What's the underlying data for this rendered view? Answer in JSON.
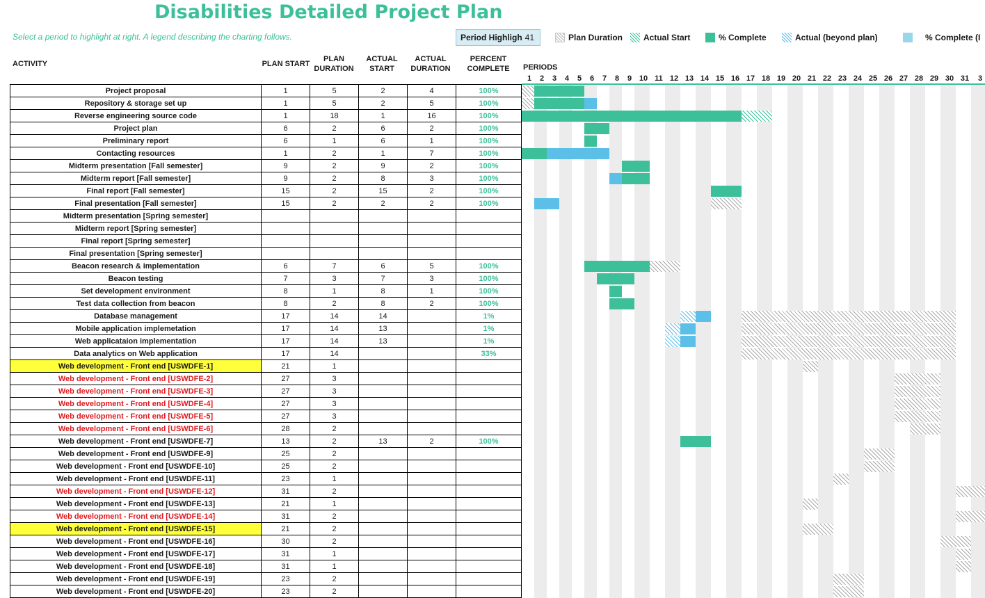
{
  "title": "Disabilities Detailed Project Plan",
  "subtitle": "Select a period to highlight at right.  A legend describing the charting follows.",
  "period_highlight": {
    "label": "Period Highligh",
    "value": "41"
  },
  "legend": [
    "Plan Duration",
    "Actual Start",
    "% Complete",
    "Actual (beyond plan)",
    "% Complete (I"
  ],
  "colors": {
    "accent": "#3dbf9a",
    "blue": "#5bbfe8",
    "highlight": "#ffff3a",
    "red_text": "#e0191e"
  },
  "headers": {
    "activity": "ACTIVITY",
    "plan_start": "PLAN START",
    "plan_duration": "PLAN DURATION",
    "actual_start": "ACTUAL START",
    "actual_duration": "ACTUAL DURATION",
    "percent_complete": "PERCENT COMPLETE",
    "periods": "PERIODS"
  },
  "period_numbers": [
    "1",
    "2",
    "3",
    "4",
    "5",
    "6",
    "7",
    "8",
    "9",
    "10",
    "11",
    "12",
    "13",
    "14",
    "15",
    "16",
    "17",
    "18",
    "19",
    "20",
    "21",
    "22",
    "23",
    "24",
    "25",
    "26",
    "27",
    "28",
    "29",
    "30",
    "31",
    "3"
  ],
  "rows": [
    {
      "activity": "Project proposal",
      "plan_start": "1",
      "plan_duration": "5",
      "actual_start": "2",
      "actual_duration": "4",
      "percent": "100%",
      "style": ""
    },
    {
      "activity": "Repository & storage set up",
      "plan_start": "1",
      "plan_duration": "5",
      "actual_start": "2",
      "actual_duration": "5",
      "percent": "100%",
      "style": ""
    },
    {
      "activity": "Reverse engineering source code",
      "plan_start": "1",
      "plan_duration": "18",
      "actual_start": "1",
      "actual_duration": "16",
      "percent": "100%",
      "style": ""
    },
    {
      "activity": "Project plan",
      "plan_start": "6",
      "plan_duration": "2",
      "actual_start": "6",
      "actual_duration": "2",
      "percent": "100%",
      "style": ""
    },
    {
      "activity": "Preliminary report",
      "plan_start": "6",
      "plan_duration": "1",
      "actual_start": "6",
      "actual_duration": "1",
      "percent": "100%",
      "style": ""
    },
    {
      "activity": "Contacting resources",
      "plan_start": "1",
      "plan_duration": "2",
      "actual_start": "1",
      "actual_duration": "7",
      "percent": "100%",
      "style": ""
    },
    {
      "activity": "Midterm presentation [Fall semester]",
      "plan_start": "9",
      "plan_duration": "2",
      "actual_start": "9",
      "actual_duration": "2",
      "percent": "100%",
      "style": ""
    },
    {
      "activity": "Midterm report [Fall semester]",
      "plan_start": "9",
      "plan_duration": "2",
      "actual_start": "8",
      "actual_duration": "3",
      "percent": "100%",
      "style": ""
    },
    {
      "activity": "Final report [Fall semester]",
      "plan_start": "15",
      "plan_duration": "2",
      "actual_start": "15",
      "actual_duration": "2",
      "percent": "100%",
      "style": ""
    },
    {
      "activity": "Final presentation [Fall semester]",
      "plan_start": "15",
      "plan_duration": "2",
      "actual_start": "2",
      "actual_duration": "2",
      "percent": "100%",
      "style": ""
    },
    {
      "activity": "Midterm presentation [Spring semester]",
      "plan_start": "",
      "plan_duration": "",
      "actual_start": "",
      "actual_duration": "",
      "percent": "",
      "style": ""
    },
    {
      "activity": "Midterm report [Spring semester]",
      "plan_start": "",
      "plan_duration": "",
      "actual_start": "",
      "actual_duration": "",
      "percent": "",
      "style": ""
    },
    {
      "activity": "Final report [Spring semester]",
      "plan_start": "",
      "plan_duration": "",
      "actual_start": "",
      "actual_duration": "",
      "percent": "",
      "style": ""
    },
    {
      "activity": "Final presentation [Spring semester]",
      "plan_start": "",
      "plan_duration": "",
      "actual_start": "",
      "actual_duration": "",
      "percent": "",
      "style": ""
    },
    {
      "activity": "Beacon research & implementation",
      "plan_start": "6",
      "plan_duration": "7",
      "actual_start": "6",
      "actual_duration": "5",
      "percent": "100%",
      "style": ""
    },
    {
      "activity": "Beacon testing",
      "plan_start": "7",
      "plan_duration": "3",
      "actual_start": "7",
      "actual_duration": "3",
      "percent": "100%",
      "style": ""
    },
    {
      "activity": "Set development environment",
      "plan_start": "8",
      "plan_duration": "1",
      "actual_start": "8",
      "actual_duration": "1",
      "percent": "100%",
      "style": ""
    },
    {
      "activity": "Test data collection from beacon",
      "plan_start": "8",
      "plan_duration": "2",
      "actual_start": "8",
      "actual_duration": "2",
      "percent": "100%",
      "style": ""
    },
    {
      "activity": "Database management",
      "plan_start": "17",
      "plan_duration": "14",
      "actual_start": "14",
      "actual_duration": "",
      "percent": "1%",
      "style": ""
    },
    {
      "activity": "Mobile application implemetation",
      "plan_start": "17",
      "plan_duration": "14",
      "actual_start": "13",
      "actual_duration": "",
      "percent": "1%",
      "style": ""
    },
    {
      "activity": "Web applicataion implementation",
      "plan_start": "17",
      "plan_duration": "14",
      "actual_start": "13",
      "actual_duration": "",
      "percent": "1%",
      "style": ""
    },
    {
      "activity": "Data analytics on Web application",
      "plan_start": "17",
      "plan_duration": "14",
      "actual_start": "",
      "actual_duration": "",
      "percent": "33%",
      "style": ""
    },
    {
      "activity": "Web development - Front end [USWDFE-1]",
      "plan_start": "21",
      "plan_duration": "1",
      "actual_start": "",
      "actual_duration": "",
      "percent": "",
      "style": "hl"
    },
    {
      "activity": "Web development - Front end [USWDFE-2]",
      "plan_start": "27",
      "plan_duration": "3",
      "actual_start": "",
      "actual_duration": "",
      "percent": "",
      "style": "red"
    },
    {
      "activity": "Web development - Front end [USWDFE-3]",
      "plan_start": "27",
      "plan_duration": "3",
      "actual_start": "",
      "actual_duration": "",
      "percent": "",
      "style": "red"
    },
    {
      "activity": "Web development - Front end [USWDFE-4]",
      "plan_start": "27",
      "plan_duration": "3",
      "actual_start": "",
      "actual_duration": "",
      "percent": "",
      "style": "red"
    },
    {
      "activity": "Web development - Front end [USWDFE-5]",
      "plan_start": "27",
      "plan_duration": "3",
      "actual_start": "",
      "actual_duration": "",
      "percent": "",
      "style": "red"
    },
    {
      "activity": "Web development - Front end [USWDFE-6]",
      "plan_start": "28",
      "plan_duration": "2",
      "actual_start": "",
      "actual_duration": "",
      "percent": "",
      "style": "red"
    },
    {
      "activity": "Web development - Front end [USWDFE-7]",
      "plan_start": "13",
      "plan_duration": "2",
      "actual_start": "13",
      "actual_duration": "2",
      "percent": "100%",
      "style": ""
    },
    {
      "activity": "Web development - Front end [USWDFE-9]",
      "plan_start": "25",
      "plan_duration": "2",
      "actual_start": "",
      "actual_duration": "",
      "percent": "",
      "style": ""
    },
    {
      "activity": "Web development - Front end [USWDFE-10]",
      "plan_start": "25",
      "plan_duration": "2",
      "actual_start": "",
      "actual_duration": "",
      "percent": "",
      "style": ""
    },
    {
      "activity": "Web development - Front end [USWDFE-11]",
      "plan_start": "23",
      "plan_duration": "1",
      "actual_start": "",
      "actual_duration": "",
      "percent": "",
      "style": ""
    },
    {
      "activity": "Web development - Front end [USWDFE-12]",
      "plan_start": "31",
      "plan_duration": "2",
      "actual_start": "",
      "actual_duration": "",
      "percent": "",
      "style": "red"
    },
    {
      "activity": "Web development - Front end [USWDFE-13]",
      "plan_start": "21",
      "plan_duration": "1",
      "actual_start": "",
      "actual_duration": "",
      "percent": "",
      "style": ""
    },
    {
      "activity": "Web development - Front end [USWDFE-14]",
      "plan_start": "31",
      "plan_duration": "2",
      "actual_start": "",
      "actual_duration": "",
      "percent": "",
      "style": "red"
    },
    {
      "activity": "Web development - Front end [USWDFE-15]",
      "plan_start": "21",
      "plan_duration": "2",
      "actual_start": "",
      "actual_duration": "",
      "percent": "",
      "style": "hl"
    },
    {
      "activity": "Web development - Front end [USWDFE-16]",
      "plan_start": "30",
      "plan_duration": "2",
      "actual_start": "",
      "actual_duration": "",
      "percent": "",
      "style": ""
    },
    {
      "activity": "Web development - Front end [USWDFE-17]",
      "plan_start": "31",
      "plan_duration": "1",
      "actual_start": "",
      "actual_duration": "",
      "percent": "",
      "style": ""
    },
    {
      "activity": "Web development - Front end [USWDFE-18]",
      "plan_start": "31",
      "plan_duration": "1",
      "actual_start": "",
      "actual_duration": "",
      "percent": "",
      "style": ""
    },
    {
      "activity": "Web development - Front end [USWDFE-19]",
      "plan_start": "23",
      "plan_duration": "2",
      "actual_start": "",
      "actual_duration": "",
      "percent": "",
      "style": ""
    },
    {
      "activity": "Web development - Front end [USWDFE-20]",
      "plan_start": "23",
      "plan_duration": "2",
      "actual_start": "",
      "actual_duration": "",
      "percent": "",
      "style": ""
    }
  ],
  "gantt_bars": [
    {
      "row": 0,
      "start": 1,
      "len": 1,
      "kind": "plan"
    },
    {
      "row": 0,
      "start": 2,
      "len": 4,
      "kind": "comp"
    },
    {
      "row": 1,
      "start": 1,
      "len": 1,
      "kind": "plan"
    },
    {
      "row": 1,
      "start": 2,
      "len": 4,
      "kind": "comp"
    },
    {
      "row": 1,
      "start": 6,
      "len": 1,
      "kind": "blue"
    },
    {
      "row": 2,
      "start": 1,
      "len": 16,
      "kind": "comp"
    },
    {
      "row": 2,
      "start": 17,
      "len": 2,
      "kind": "hatchg"
    },
    {
      "row": 3,
      "start": 6,
      "len": 2,
      "kind": "comp"
    },
    {
      "row": 4,
      "start": 6,
      "len": 1,
      "kind": "comp"
    },
    {
      "row": 5,
      "start": 1,
      "len": 2,
      "kind": "comp"
    },
    {
      "row": 5,
      "start": 3,
      "len": 5,
      "kind": "blue"
    },
    {
      "row": 6,
      "start": 9,
      "len": 2,
      "kind": "comp"
    },
    {
      "row": 7,
      "start": 8,
      "len": 1,
      "kind": "blue"
    },
    {
      "row": 7,
      "start": 9,
      "len": 2,
      "kind": "comp"
    },
    {
      "row": 8,
      "start": 15,
      "len": 2,
      "kind": "comp"
    },
    {
      "row": 9,
      "start": 2,
      "len": 2,
      "kind": "blue"
    },
    {
      "row": 9,
      "start": 15,
      "len": 2,
      "kind": "plan"
    },
    {
      "row": 14,
      "start": 6,
      "len": 5,
      "kind": "comp"
    },
    {
      "row": 14,
      "start": 11,
      "len": 2,
      "kind": "plan"
    },
    {
      "row": 15,
      "start": 7,
      "len": 3,
      "kind": "comp"
    },
    {
      "row": 16,
      "start": 8,
      "len": 1,
      "kind": "comp"
    },
    {
      "row": 17,
      "start": 8,
      "len": 2,
      "kind": "comp"
    },
    {
      "row": 18,
      "start": 13,
      "len": 1,
      "kind": "hatchb"
    },
    {
      "row": 18,
      "start": 14,
      "len": 1,
      "kind": "blue"
    },
    {
      "row": 18,
      "start": 17,
      "len": 14,
      "kind": "plan"
    },
    {
      "row": 19,
      "start": 12,
      "len": 1,
      "kind": "hatchb"
    },
    {
      "row": 19,
      "start": 13,
      "len": 1,
      "kind": "blue"
    },
    {
      "row": 19,
      "start": 17,
      "len": 14,
      "kind": "plan"
    },
    {
      "row": 20,
      "start": 12,
      "len": 1,
      "kind": "hatchb"
    },
    {
      "row": 20,
      "start": 13,
      "len": 1,
      "kind": "blue"
    },
    {
      "row": 20,
      "start": 17,
      "len": 14,
      "kind": "plan"
    },
    {
      "row": 21,
      "start": 17,
      "len": 14,
      "kind": "plan"
    },
    {
      "row": 22,
      "start": 21,
      "len": 1,
      "kind": "plan"
    },
    {
      "row": 23,
      "start": 27,
      "len": 3,
      "kind": "plan"
    },
    {
      "row": 24,
      "start": 27,
      "len": 3,
      "kind": "plan"
    },
    {
      "row": 25,
      "start": 27,
      "len": 3,
      "kind": "plan"
    },
    {
      "row": 26,
      "start": 27,
      "len": 3,
      "kind": "plan"
    },
    {
      "row": 27,
      "start": 28,
      "len": 2,
      "kind": "plan"
    },
    {
      "row": 28,
      "start": 13,
      "len": 2,
      "kind": "comp"
    },
    {
      "row": 29,
      "start": 25,
      "len": 2,
      "kind": "plan"
    },
    {
      "row": 30,
      "start": 25,
      "len": 2,
      "kind": "plan"
    },
    {
      "row": 31,
      "start": 23,
      "len": 1,
      "kind": "plan"
    },
    {
      "row": 32,
      "start": 31,
      "len": 2,
      "kind": "plan"
    },
    {
      "row": 33,
      "start": 21,
      "len": 1,
      "kind": "plan"
    },
    {
      "row": 34,
      "start": 31,
      "len": 2,
      "kind": "plan"
    },
    {
      "row": 35,
      "start": 21,
      "len": 2,
      "kind": "plan"
    },
    {
      "row": 36,
      "start": 30,
      "len": 2,
      "kind": "plan"
    },
    {
      "row": 37,
      "start": 31,
      "len": 1,
      "kind": "plan"
    },
    {
      "row": 38,
      "start": 31,
      "len": 1,
      "kind": "plan"
    },
    {
      "row": 39,
      "start": 23,
      "len": 2,
      "kind": "plan"
    },
    {
      "row": 40,
      "start": 23,
      "len": 2,
      "kind": "plan"
    }
  ]
}
